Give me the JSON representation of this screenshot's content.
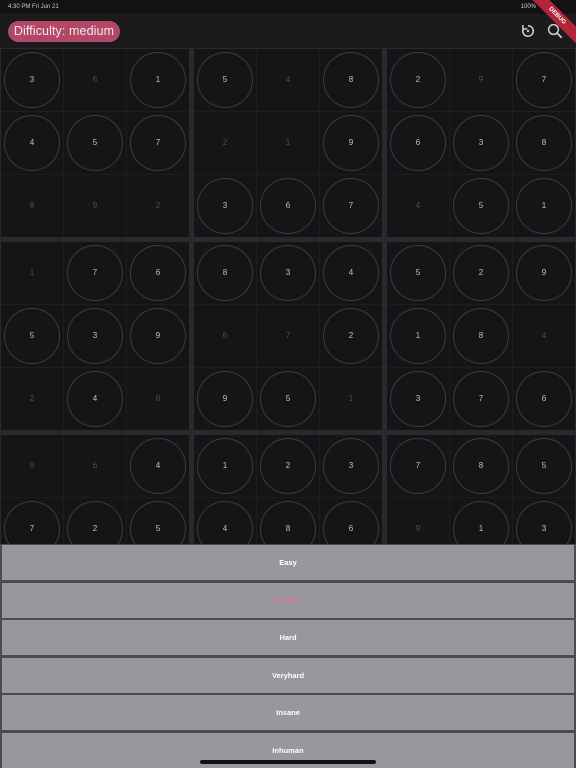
{
  "status_bar": {
    "time": "4:30 PM  Fri Jun 21",
    "right": "100%"
  },
  "app_bar": {
    "difficulty_label": "Difficulty: medium",
    "debug_label": "DEBUG",
    "icons": [
      "reset-icon",
      "search-icon"
    ]
  },
  "board": {
    "rows": [
      [
        "3",
        "6",
        "1",
        "5",
        "4",
        "8",
        "2",
        "9",
        "7"
      ],
      [
        "4",
        "5",
        "7",
        "2",
        "1",
        "9",
        "6",
        "3",
        "8"
      ],
      [
        "8",
        "9",
        "2",
        "3",
        "6",
        "7",
        "4",
        "5",
        "1"
      ],
      [
        "1",
        "7",
        "6",
        "8",
        "3",
        "4",
        "5",
        "2",
        "9"
      ],
      [
        "5",
        "3",
        "9",
        "6",
        "7",
        "2",
        "1",
        "8",
        "4"
      ],
      [
        "2",
        "4",
        "8",
        "9",
        "5",
        "1",
        "3",
        "7",
        "6"
      ],
      [
        "9",
        "6",
        "4",
        "1",
        "2",
        "3",
        "7",
        "8",
        "5"
      ],
      [
        "7",
        "2",
        "5",
        "4",
        "8",
        "6",
        "9",
        "1",
        "3"
      ]
    ],
    "given": [
      [
        false,
        true,
        false,
        false,
        true,
        false,
        false,
        true,
        false
      ],
      [
        false,
        false,
        false,
        true,
        true,
        false,
        false,
        false,
        false
      ],
      [
        true,
        true,
        true,
        false,
        false,
        false,
        true,
        false,
        false
      ],
      [
        true,
        false,
        false,
        false,
        false,
        false,
        false,
        false,
        false
      ],
      [
        false,
        false,
        false,
        true,
        true,
        false,
        false,
        false,
        true
      ],
      [
        true,
        false,
        true,
        false,
        false,
        true,
        false,
        false,
        false
      ],
      [
        true,
        true,
        false,
        false,
        false,
        false,
        false,
        false,
        false
      ],
      [
        false,
        false,
        false,
        false,
        false,
        false,
        true,
        false,
        false
      ]
    ]
  },
  "difficulty_sheet": {
    "options": [
      {
        "label": "Easy",
        "selected": false
      },
      {
        "label": "Medium",
        "selected": true
      },
      {
        "label": "Hard",
        "selected": false
      },
      {
        "label": "Veryhard",
        "selected": false
      },
      {
        "label": "Insane",
        "selected": false
      },
      {
        "label": "Inhuman",
        "selected": false
      }
    ]
  },
  "colors": {
    "accent": "#b24866",
    "selected_option_text": "#ea6b95",
    "board_background": "#151417",
    "sheet_option_background": "#98979b"
  }
}
